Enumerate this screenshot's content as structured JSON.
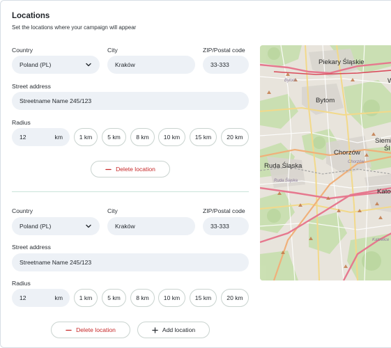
{
  "section": {
    "title": "Locations",
    "subtitle": "Set the locations where your campaign will appear"
  },
  "labels": {
    "country": "Country",
    "city": "City",
    "zip": "ZIP/Postal code",
    "street": "Street address",
    "radius": "Radius"
  },
  "locations": [
    {
      "country": "Poland (PL)",
      "city": "Kraków",
      "zip": "33-333",
      "street": "Streetname Name 245/123",
      "radius_value": "12",
      "radius_unit": "km",
      "radius_options": [
        "1 km",
        "5 km",
        "8 km",
        "10 km",
        "15 km",
        "20 km"
      ],
      "delete_label": "Delete location"
    },
    {
      "country": "Poland (PL)",
      "city": "Kraków",
      "zip": "33-333",
      "street": "Streetname Name 245/123",
      "radius_value": "12",
      "radius_unit": "km",
      "radius_options": [
        "1 km",
        "5 km",
        "8 km",
        "10 km",
        "15 km",
        "20 km"
      ],
      "delete_label": "Delete location"
    }
  ],
  "actions": {
    "add_location_label": "Add location"
  },
  "map": {
    "cities": {
      "piekary": "Piekary Śląskie",
      "bytom": "Bytom",
      "chorzow": "Chorzów",
      "chorzow_small": "Chorzów",
      "ruda": "Ruda Śląska",
      "ruda_small": "Ruda Śląska",
      "siem": "Siemi",
      "sl": "Śl",
      "kato": "Kato",
      "katowice_small": "Katowice",
      "w": "W",
      "bytom_small": "Bytom"
    }
  },
  "colors": {
    "danger": "#c62828",
    "field_bg": "#edf1f6",
    "divider": "#c9e3d9"
  }
}
